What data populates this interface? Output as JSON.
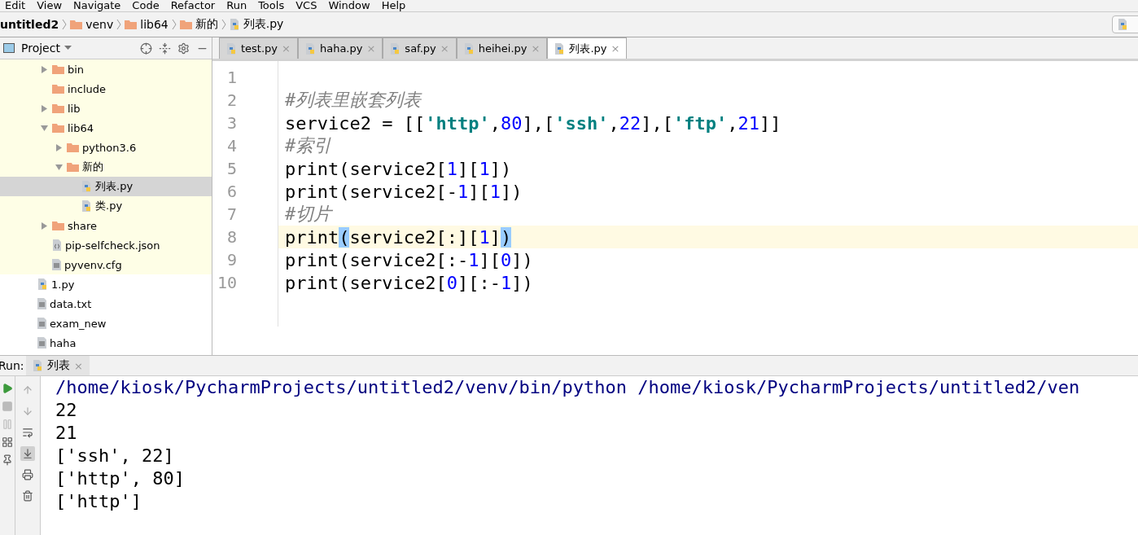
{
  "menu": [
    "Edit",
    "View",
    "Navigate",
    "Code",
    "Refactor",
    "Run",
    "Tools",
    "VCS",
    "Window",
    "Help"
  ],
  "breadcrumbs": [
    {
      "label": "untitled2",
      "kind": "project"
    },
    {
      "label": "venv",
      "kind": "folder"
    },
    {
      "label": "lib64",
      "kind": "folder"
    },
    {
      "label": "新的",
      "kind": "folder"
    },
    {
      "label": "列表.py",
      "kind": "py"
    }
  ],
  "project_panel": {
    "title": "Project"
  },
  "tree": [
    {
      "excluded": true,
      "children": [
        {
          "label": "bin",
          "kind": "folder",
          "expanded": false,
          "selected": false
        },
        {
          "label": "include",
          "kind": "folder",
          "selected": false
        },
        {
          "label": "lib",
          "kind": "folder",
          "expanded": false,
          "selected": false
        },
        {
          "label": "lib64",
          "kind": "folder",
          "expanded": true,
          "selected": false,
          "children": [
            {
              "label": "python3.6",
              "kind": "folder",
              "expanded": false,
              "selected": false
            },
            {
              "label": "新的",
              "kind": "folder",
              "expanded": true,
              "selected": false,
              "children": [
                {
                  "label": "列表.py",
                  "kind": "py",
                  "selected": true
                },
                {
                  "label": "类.py",
                  "kind": "py",
                  "selected": false
                }
              ]
            }
          ]
        },
        {
          "label": "share",
          "kind": "folder",
          "expanded": false,
          "selected": false
        },
        {
          "label": "pip-selfcheck.json",
          "kind": "json",
          "selected": false
        },
        {
          "label": "pyvenv.cfg",
          "kind": "text",
          "selected": false
        }
      ]
    },
    {
      "label": "1.py",
      "kind": "py",
      "selected": false
    },
    {
      "label": "data.txt",
      "kind": "text",
      "selected": false
    },
    {
      "label": "exam_new",
      "kind": "text",
      "selected": false
    },
    {
      "label": "haha",
      "kind": "text",
      "selected": false
    }
  ],
  "tabs": [
    {
      "label": "test.py",
      "selected": false
    },
    {
      "label": "haha.py",
      "selected": false
    },
    {
      "label": "saf.py",
      "selected": false
    },
    {
      "label": "heihei.py",
      "selected": false
    },
    {
      "label": "列表.py",
      "selected": true
    }
  ],
  "close_mark": "×",
  "code": [
    {
      "number": "1"
    },
    {
      "number": "2",
      "tokens": [
        {
          "text": "#列表里嵌套列表",
          "kind": "comment"
        }
      ]
    },
    {
      "number": "3",
      "tokens": [
        {
          "text": "service2 = [[",
          "kind": "plain"
        },
        {
          "text": "'http'",
          "kind": "string"
        },
        {
          "text": ",",
          "kind": "plain"
        },
        {
          "text": "80",
          "kind": "number"
        },
        {
          "text": "],[",
          "kind": "plain"
        },
        {
          "text": "'ssh'",
          "kind": "string"
        },
        {
          "text": ",",
          "kind": "plain"
        },
        {
          "text": "22",
          "kind": "number"
        },
        {
          "text": "],[",
          "kind": "plain"
        },
        {
          "text": "'ftp'",
          "kind": "string"
        },
        {
          "text": ",",
          "kind": "plain"
        },
        {
          "text": "21",
          "kind": "number"
        },
        {
          "text": "]]",
          "kind": "plain"
        }
      ]
    },
    {
      "number": "4",
      "tokens": [
        {
          "text": "#索引",
          "kind": "comment"
        }
      ]
    },
    {
      "number": "5",
      "tokens": [
        {
          "text": "print(service2[",
          "kind": "plain"
        },
        {
          "text": "1",
          "kind": "number"
        },
        {
          "text": "][",
          "kind": "plain"
        },
        {
          "text": "1",
          "kind": "number"
        },
        {
          "text": "])",
          "kind": "plain"
        }
      ]
    },
    {
      "number": "6",
      "tokens": [
        {
          "text": "print(service2[-",
          "kind": "plain"
        },
        {
          "text": "1",
          "kind": "number"
        },
        {
          "text": "][",
          "kind": "plain"
        },
        {
          "text": "1",
          "kind": "number"
        },
        {
          "text": "])",
          "kind": "plain"
        }
      ]
    },
    {
      "number": "7",
      "tokens": [
        {
          "text": "#切片",
          "kind": "comment"
        }
      ]
    },
    {
      "number": "8",
      "current": true,
      "tokens": [
        {
          "text": "print",
          "kind": "plain"
        },
        {
          "text": "(",
          "kind": "match"
        },
        {
          "text": "service2[:][",
          "kind": "plain"
        },
        {
          "text": "1",
          "kind": "number"
        },
        {
          "text": "]",
          "kind": "plain"
        },
        {
          "text": ")",
          "kind": "match"
        }
      ]
    },
    {
      "number": "9",
      "tokens": [
        {
          "text": "print(service2[:-",
          "kind": "plain"
        },
        {
          "text": "1",
          "kind": "number"
        },
        {
          "text": "][",
          "kind": "plain"
        },
        {
          "text": "0",
          "kind": "number"
        },
        {
          "text": "])",
          "kind": "plain"
        }
      ]
    },
    {
      "number": "10",
      "tokens": [
        {
          "text": "print(service2[",
          "kind": "plain"
        },
        {
          "text": "0",
          "kind": "number"
        },
        {
          "text": "][:-",
          "kind": "plain"
        },
        {
          "text": "1",
          "kind": "number"
        },
        {
          "text": "])",
          "kind": "plain"
        }
      ]
    }
  ],
  "run_panel": {
    "label": "Run:",
    "tab": "列表",
    "scroll_to_end_on": true
  },
  "console": [
    {
      "text": "/home/kiosk/PycharmProjects/untitled2/venv/bin/python /home/kiosk/PycharmProjects/untitled2/ven",
      "kind": "command"
    },
    {
      "text": "22",
      "kind": "output"
    },
    {
      "text": "21",
      "kind": "output"
    },
    {
      "text": "['ssh', 22]",
      "kind": "output"
    },
    {
      "text": "['http', 80]",
      "kind": "output"
    },
    {
      "text": "['http']",
      "kind": "output"
    }
  ]
}
